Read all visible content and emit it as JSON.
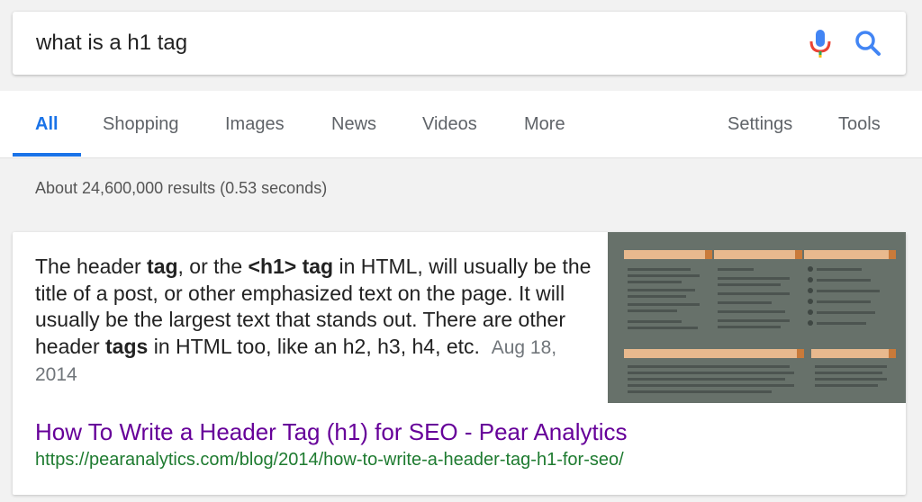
{
  "search": {
    "query": "what is a h1 tag"
  },
  "tabs": [
    {
      "label": "All",
      "active": true
    },
    {
      "label": "Shopping"
    },
    {
      "label": "Images"
    },
    {
      "label": "News"
    },
    {
      "label": "Videos"
    },
    {
      "label": "More"
    },
    {
      "label": "Settings"
    },
    {
      "label": "Tools"
    }
  ],
  "results_count": "About 24,600,000 results (0.53 seconds)",
  "featured_snippet": {
    "text_1": "The header ",
    "bold_1": "tag",
    "text_2": ", or the ",
    "bold_2": "<h1> tag",
    "text_3": " in HTML, will usually be the title of a post, or other emphasized text on the page. It will usually be the largest text that stands out. There are other header ",
    "bold_3": "tags",
    "text_4": " in HTML too, like an h2, h3, h4, etc.",
    "date": "Aug 18, 2014",
    "title": "How To Write a Header Tag (h1) for SEO - Pear Analytics",
    "url": "https://pearanalytics.com/blog/2014/how-to-write-a-header-tag-h1-for-seo/"
  },
  "colors": {
    "accent": "#1a73e8",
    "visited_link": "#660099",
    "url_green": "#1e7b30"
  }
}
